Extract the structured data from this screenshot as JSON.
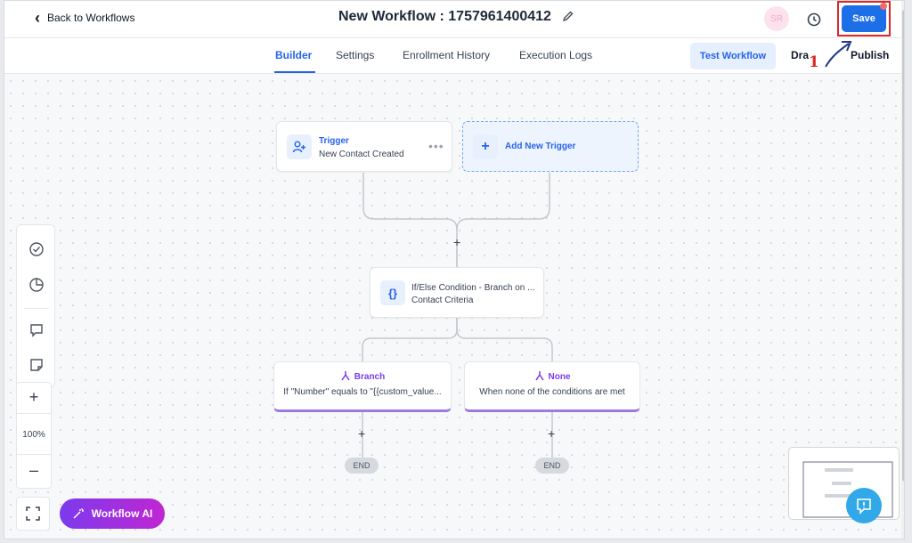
{
  "header": {
    "back_label": "Back to Workflows",
    "workflow_title": "New Workflow : 1757961400412",
    "avatar_initials": "SR",
    "save_label": "Save"
  },
  "tabs": {
    "items": [
      {
        "label": "Builder",
        "active": true
      },
      {
        "label": "Settings",
        "active": false
      },
      {
        "label": "Enrollment History",
        "active": false
      },
      {
        "label": "Execution Logs",
        "active": false
      }
    ],
    "test_label": "Test Workflow",
    "draft_label": "Dra",
    "publish_label": "Publish"
  },
  "annotation": {
    "step_number": "1",
    "color": "#dc2626"
  },
  "nodes": {
    "trigger": {
      "title": "Trigger",
      "subtitle": "New Contact Created",
      "more": "•••"
    },
    "add_trigger": {
      "label": "Add New Trigger",
      "plus": "+"
    },
    "condition": {
      "line1": "If/Else Condition - Branch on ...",
      "line2": "Contact Criteria",
      "icon_text": "{}"
    },
    "branch": {
      "title": "Branch",
      "desc": "If \"Number\" equals to \"{{custom_value..."
    },
    "none": {
      "title": "None",
      "desc": "When none of the conditions are met"
    },
    "end_label": "END",
    "add_step": "+"
  },
  "controls": {
    "zoom_in": "+",
    "zoom_level": "100%",
    "zoom_out": "–",
    "ai_label": "Workflow AI"
  },
  "colors": {
    "primary": "#1d6fe8",
    "branch": "#7c3aed",
    "ai_gradient_start": "#7c3aed",
    "ai_gradient_end": "#c026d3"
  }
}
